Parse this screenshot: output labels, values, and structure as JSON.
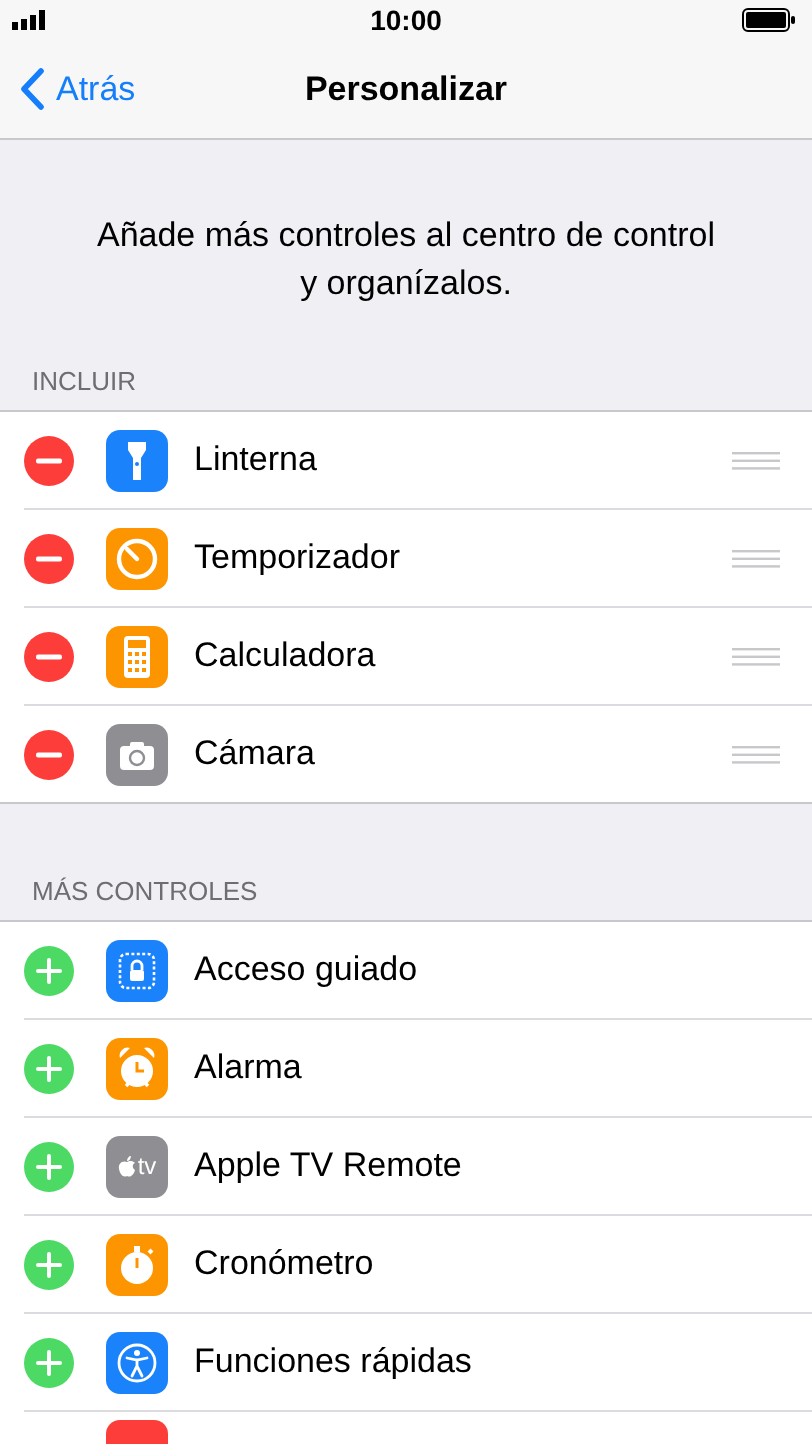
{
  "status_bar": {
    "time": "10:00"
  },
  "nav": {
    "back": "Atrás",
    "title": "Personalizar"
  },
  "description": "Añade más controles al centro de control y organízalos.",
  "sections": [
    {
      "header": "INCLUIR",
      "items": [
        {
          "kind": "remove",
          "color": "#1a82fb",
          "label": "Linterna"
        },
        {
          "kind": "remove",
          "color": "#fd9500",
          "label": "Temporizador"
        },
        {
          "kind": "remove",
          "color": "#fd9500",
          "label": "Calculadora"
        },
        {
          "kind": "remove",
          "color": "#8e8e93",
          "label": "Cámara"
        }
      ]
    },
    {
      "header": "MÁS CONTROLES",
      "items": [
        {
          "kind": "add",
          "color": "#1a82fb",
          "label": "Acceso guiado"
        },
        {
          "kind": "add",
          "color": "#fd9500",
          "label": "Alarma"
        },
        {
          "kind": "add",
          "color": "#8e8e93",
          "label": "Apple TV Remote",
          "icon_text": "tv"
        },
        {
          "kind": "add",
          "color": "#fd9500",
          "label": "Cronómetro"
        },
        {
          "kind": "add",
          "color": "#1a82fb",
          "label": "Funciones rápidas"
        },
        {
          "kind": "partial",
          "color": "#fc3d39"
        }
      ]
    }
  ]
}
